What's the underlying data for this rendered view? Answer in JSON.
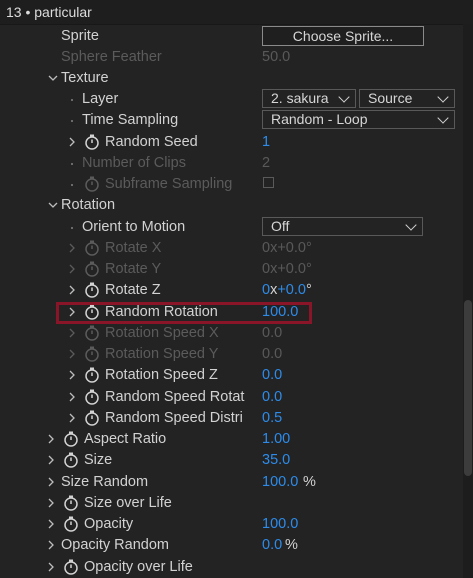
{
  "header": {
    "title": "13 • particular"
  },
  "rows": {
    "sprite": {
      "label": "Sprite",
      "button": "Choose Sprite..."
    },
    "sphere_feather": {
      "label": "Sphere Feather",
      "value": "50.0"
    },
    "texture": {
      "label": "Texture"
    },
    "layer": {
      "label": "Layer",
      "layer_value": "2. sakura",
      "source_value": "Source"
    },
    "time_sampling": {
      "label": "Time Sampling",
      "value": "Random - Loop"
    },
    "random_seed": {
      "label": "Random Seed",
      "value": "1"
    },
    "number_of_clips": {
      "label": "Number of Clips",
      "value": "2"
    },
    "subframe_sampling": {
      "label": "Subframe Sampling"
    },
    "rotation": {
      "label": "Rotation"
    },
    "orient_to_motion": {
      "label": "Orient to Motion",
      "value": "Off"
    },
    "rotate_x": {
      "label": "Rotate X",
      "value": "0x+0.0°"
    },
    "rotate_y": {
      "label": "Rotate Y",
      "value": "0x+0.0°"
    },
    "rotate_z": {
      "label": "Rotate Z",
      "value_prefix": "0",
      "value_mid": "x",
      "value_num": "+0.0",
      "value_suffix": "°"
    },
    "random_rotation": {
      "label": "Random Rotation",
      "value": "100.0"
    },
    "rotation_speed_x": {
      "label": "Rotation Speed X",
      "value": "0.0"
    },
    "rotation_speed_y": {
      "label": "Rotation Speed Y",
      "value": "0.0"
    },
    "rotation_speed_z": {
      "label": "Rotation Speed Z",
      "value": "0.0"
    },
    "random_speed_rotate": {
      "label": "Random Speed Rotat",
      "value": "0.0"
    },
    "random_speed_distrib": {
      "label": "Random Speed Distri",
      "value": "0.5"
    },
    "aspect_ratio": {
      "label": "Aspect Ratio",
      "value": "1.00"
    },
    "size": {
      "label": "Size",
      "value": "35.0"
    },
    "size_random": {
      "label": "Size Random",
      "value": "100.0",
      "unit": "%"
    },
    "size_over_life": {
      "label": "Size over Life"
    },
    "opacity": {
      "label": "Opacity",
      "value": "100.0"
    },
    "opacity_random": {
      "label": "Opacity Random",
      "value": "0.0",
      "unit": "%"
    },
    "opacity_over_life": {
      "label": "Opacity over Life"
    }
  },
  "colors": {
    "accent": "#2d8ceb",
    "highlight": "#8a1528",
    "background": "#232323"
  }
}
